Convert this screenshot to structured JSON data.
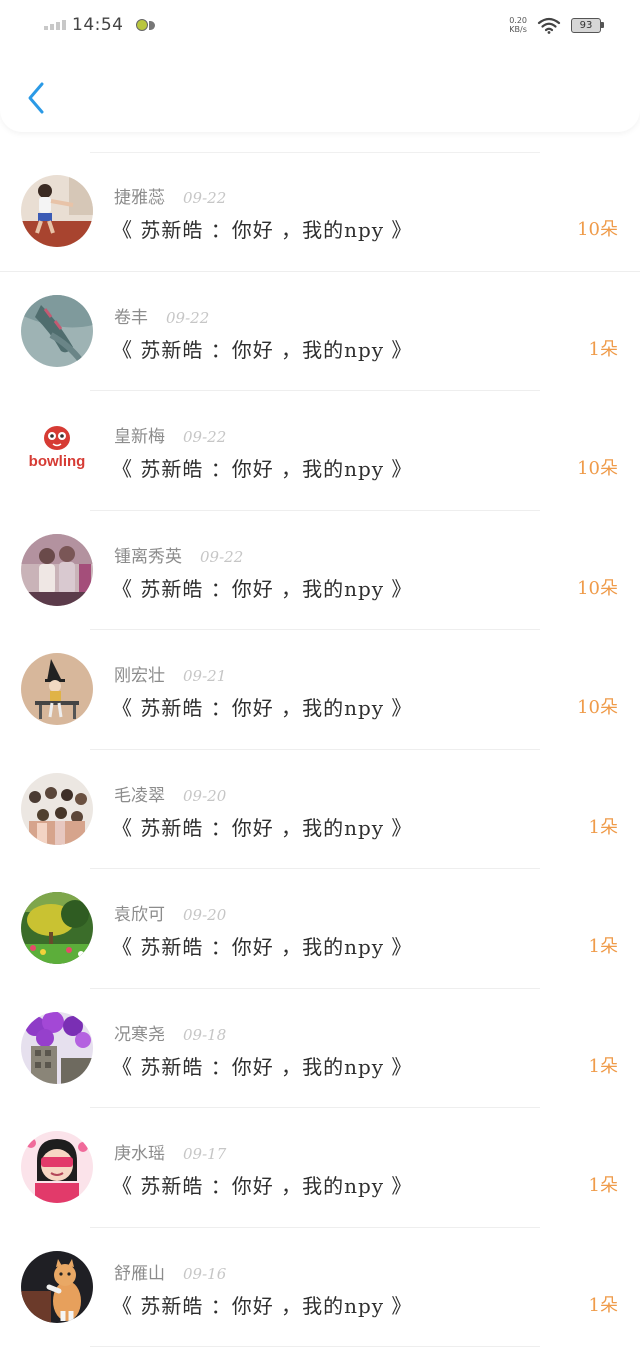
{
  "status_bar": {
    "time": "14:54",
    "net_speed_value": "0.20",
    "net_speed_unit": "KB/s",
    "battery": "93"
  },
  "nav": {
    "back_icon": "chevron-left-icon",
    "accent": "#2b9ae6"
  },
  "rows": [
    {
      "name": "捷雅蕊",
      "date": "09-22",
      "message": "《 苏新皓 ：你好 ，我的npy 》",
      "count": "10朵",
      "avatar": "child-photo"
    },
    {
      "name": "卷丰",
      "date": "09-22",
      "message": "《 苏新皓 ：你好 ，我的npy 》",
      "count": "1朵",
      "avatar": "hand-photo"
    },
    {
      "name": "皇新梅",
      "date": "09-22",
      "message": "《 苏新皓 ：你好 ，我的npy 》",
      "count": "10朵",
      "avatar": "bowling-logo",
      "logo_text": "bowling"
    },
    {
      "name": "锺离秀英",
      "date": "09-22",
      "message": "《 苏新皓 ：你好 ，我的npy 》",
      "count": "10朵",
      "avatar": "girls-photo"
    },
    {
      "name": "刚宏壮",
      "date": "09-21",
      "message": "《 苏新皓 ：你好 ，我的npy 》",
      "count": "10朵",
      "avatar": "witch-illustration"
    },
    {
      "name": "毛凌翠",
      "date": "09-20",
      "message": "《 苏新皓 ：你好 ，我的npy 》",
      "count": "1朵",
      "avatar": "group-photo"
    },
    {
      "name": "袁欣可",
      "date": "09-20",
      "message": "《 苏新皓 ：你好 ，我的npy 》",
      "count": "1朵",
      "avatar": "garden-photo"
    },
    {
      "name": "况寒尧",
      "date": "09-18",
      "message": "《 苏新皓 ：你好 ，我的npy 》",
      "count": "1朵",
      "avatar": "purple-flowers-photo"
    },
    {
      "name": "庚水瑶",
      "date": "09-17",
      "message": "《 苏新皓 ：你好 ，我的npy 》",
      "count": "1朵",
      "avatar": "cartoon-girl"
    },
    {
      "name": "舒雁山",
      "date": "09-16",
      "message": "《 苏新皓 ：你好 ，我的npy 》",
      "count": "1朵",
      "avatar": "cat-photo"
    }
  ],
  "colors": {
    "count": "#ef9b4a",
    "name": "#8c8c8c",
    "date": "#c6c6c6"
  }
}
